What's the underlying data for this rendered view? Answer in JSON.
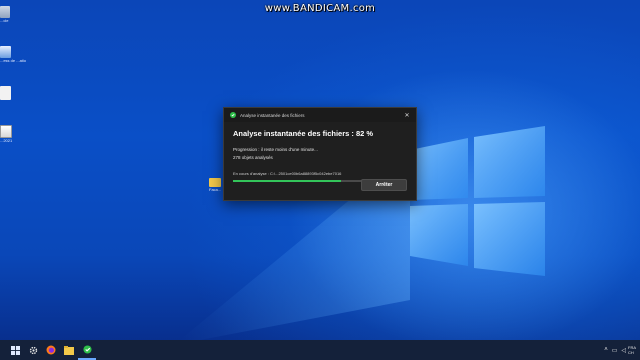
{
  "watermark": "www.BANDICAM.com",
  "desktop": {
    "icons": [
      {
        "label": "...cle"
      },
      {
        "label": "...ess de ...ation"
      },
      {
        "label": ""
      },
      {
        "label": "...2021"
      },
      {
        "label": "Faca..."
      }
    ]
  },
  "dialog": {
    "title": "Analyse instantanée des fichiers",
    "heading": "Analyse instantanée des fichiers : 82 %",
    "progress_text": "Progression : il reste moins d'une minute...",
    "objects_text": "278 objets analysés",
    "scanning_text": "En cours d'analyse : C:\\...2501ce00b6a88893f5c042ebe7016",
    "progress": 0.82,
    "stop_label": "Arrêter",
    "close_icon": "close-icon",
    "accent": "#33c45a"
  },
  "taskbar": {
    "items": [
      "windows-start-icon",
      "settings-gear-icon",
      "firefox-icon",
      "file-explorer-icon",
      "security-scan-icon"
    ],
    "tray": {
      "language": "FRA",
      "language_sub": "CH"
    }
  },
  "colors": {
    "wallpaper": "#0a4fc7",
    "dialog_bg": "#1f1f1f",
    "taskbar_bg": "#14213a"
  }
}
